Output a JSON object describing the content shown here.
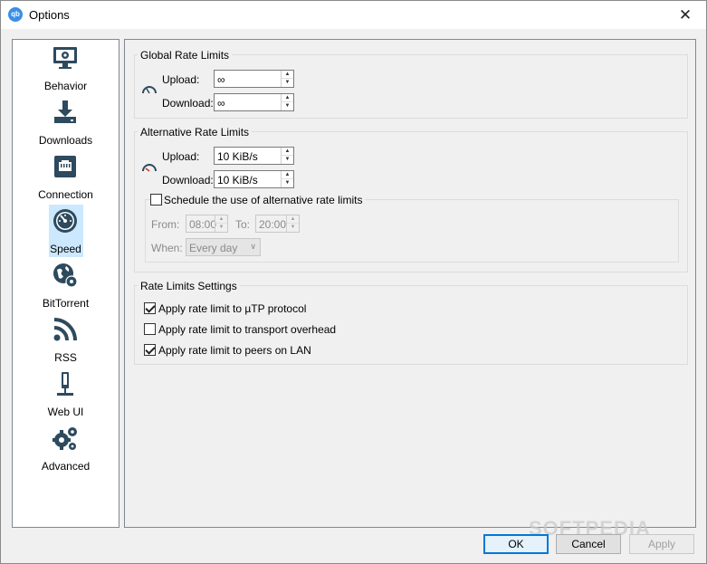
{
  "window": {
    "title": "Options",
    "app_icon_text": "qb",
    "close_glyph": "✕"
  },
  "sidebar": {
    "items": [
      {
        "label": "Behavior",
        "icon": "monitor-gear-icon",
        "selected": false
      },
      {
        "label": "Downloads",
        "icon": "download-icon",
        "selected": false
      },
      {
        "label": "Connection",
        "icon": "ethernet-port-icon",
        "selected": false
      },
      {
        "label": "Speed",
        "icon": "speedometer-icon",
        "selected": true
      },
      {
        "label": "BitTorrent",
        "icon": "globe-gear-icon",
        "selected": false
      },
      {
        "label": "RSS",
        "icon": "rss-icon",
        "selected": false
      },
      {
        "label": "Web UI",
        "icon": "web-ui-icon",
        "selected": false
      },
      {
        "label": "Advanced",
        "icon": "gears-icon",
        "selected": false
      }
    ]
  },
  "global": {
    "title": "Global Rate Limits",
    "upload_label": "Upload:",
    "upload_value": "∞",
    "download_label": "Download:",
    "download_value": "∞"
  },
  "alternative": {
    "title": "Alternative Rate Limits",
    "upload_label": "Upload:",
    "upload_value": "10 KiB/s",
    "download_label": "Download:",
    "download_value": "10 KiB/s",
    "schedule_label": "Schedule the use of alternative rate limits",
    "schedule_checked": false,
    "from_label": "From:",
    "from_value": "08:00",
    "to_label": "To:",
    "to_value": "20:00",
    "when_label": "When:",
    "when_value": "Every day"
  },
  "settings": {
    "title": "Rate Limits Settings",
    "items": [
      {
        "label": "Apply rate limit to µTP protocol",
        "checked": true
      },
      {
        "label": "Apply rate limit to transport overhead",
        "checked": false
      },
      {
        "label": "Apply rate limit to peers on LAN",
        "checked": true
      }
    ]
  },
  "buttons": {
    "ok": "OK",
    "cancel": "Cancel",
    "apply": "Apply"
  },
  "watermark": "SOFTPEDIA",
  "colors": {
    "icon": "#2d4a5e",
    "selection": "#cce8ff",
    "accent": "#0078d7"
  }
}
